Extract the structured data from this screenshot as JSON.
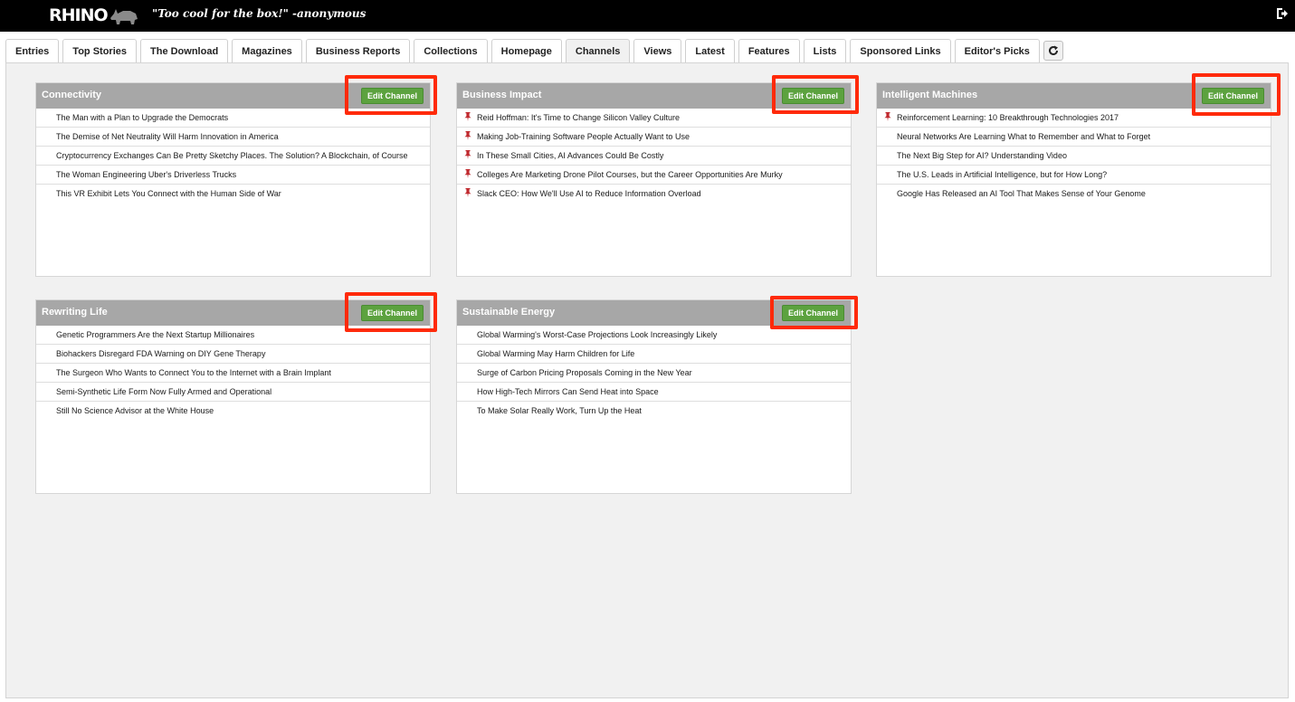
{
  "app": {
    "logo_text": "RHINO",
    "tagline": "\"Too cool for the box!\" -anonymous"
  },
  "tabs": [
    {
      "label": "Entries"
    },
    {
      "label": "Top Stories"
    },
    {
      "label": "The Download"
    },
    {
      "label": "Magazines"
    },
    {
      "label": "Business Reports"
    },
    {
      "label": "Collections"
    },
    {
      "label": "Homepage"
    },
    {
      "label": "Channels"
    },
    {
      "label": "Views"
    },
    {
      "label": "Latest"
    },
    {
      "label": "Features"
    },
    {
      "label": "Lists"
    },
    {
      "label": "Sponsored Links"
    },
    {
      "label": "Editor's Picks"
    }
  ],
  "active_tab": "Channels",
  "colors": {
    "accent_green": "#5ca23f",
    "highlight_red": "#ff2a0a",
    "panel_header": "#a7a7a7",
    "pin_red": "#c0282d"
  },
  "channels": [
    {
      "title": "Connectivity",
      "edit_label": "Edit Channel",
      "items": [
        {
          "text": "The Man with a Plan to Upgrade the Democrats",
          "pinned": false
        },
        {
          "text": "The Demise of Net Neutrality Will Harm Innovation in America",
          "pinned": false
        },
        {
          "text": "Cryptocurrency Exchanges Can Be Pretty Sketchy Places. The Solution? A Blockchain, of Course",
          "pinned": false
        },
        {
          "text": "The Woman Engineering Uber's Driverless Trucks",
          "pinned": false
        },
        {
          "text": "This VR Exhibit Lets You Connect with the Human Side of War",
          "pinned": false
        }
      ]
    },
    {
      "title": "Business Impact",
      "edit_label": "Edit Channel",
      "items": [
        {
          "text": "Reid Hoffman: It's Time to Change Silicon Valley Culture",
          "pinned": true
        },
        {
          "text": "Making Job-Training Software People Actually Want to Use",
          "pinned": true
        },
        {
          "text": "In These Small Cities, AI Advances Could Be Costly",
          "pinned": true
        },
        {
          "text": "Colleges Are Marketing Drone Pilot Courses, but the Career Opportunities Are Murky",
          "pinned": true
        },
        {
          "text": "Slack CEO: How We'll Use AI to Reduce Information Overload",
          "pinned": true
        }
      ]
    },
    {
      "title": "Intelligent Machines",
      "edit_label": "Edit Channel",
      "items": [
        {
          "text": "Reinforcement Learning: 10 Breakthrough Technologies 2017",
          "pinned": true
        },
        {
          "text": "Neural Networks Are Learning What to Remember and What to Forget",
          "pinned": false
        },
        {
          "text": "The Next Big Step for AI? Understanding Video",
          "pinned": false
        },
        {
          "text": "The U.S. Leads in Artificial Intelligence, but for How Long?",
          "pinned": false
        },
        {
          "text": "Google Has Released an AI Tool That Makes Sense of Your Genome",
          "pinned": false
        }
      ]
    },
    {
      "title": "Rewriting Life",
      "edit_label": "Edit Channel",
      "items": [
        {
          "text": "Genetic Programmers Are the Next Startup Millionaires",
          "pinned": false
        },
        {
          "text": "Biohackers Disregard FDA Warning on DIY Gene Therapy",
          "pinned": false
        },
        {
          "text": "The Surgeon Who Wants to Connect You to the Internet with a Brain Implant",
          "pinned": false
        },
        {
          "text": "Semi-Synthetic Life Form Now Fully Armed and Operational",
          "pinned": false
        },
        {
          "text": "Still No Science Advisor at the White House",
          "pinned": false
        }
      ]
    },
    {
      "title": "Sustainable Energy",
      "edit_label": "Edit Channel",
      "items": [
        {
          "text": "Global Warming's Worst-Case Projections Look Increasingly Likely",
          "pinned": false
        },
        {
          "text": "Global Warming May Harm Children for Life",
          "pinned": false
        },
        {
          "text": "Surge of Carbon Pricing Proposals Coming in the New Year",
          "pinned": false
        },
        {
          "text": "How High-Tech Mirrors Can Send Heat into Space",
          "pinned": false
        },
        {
          "text": "To Make Solar Really Work, Turn Up the Heat",
          "pinned": false
        }
      ]
    }
  ]
}
